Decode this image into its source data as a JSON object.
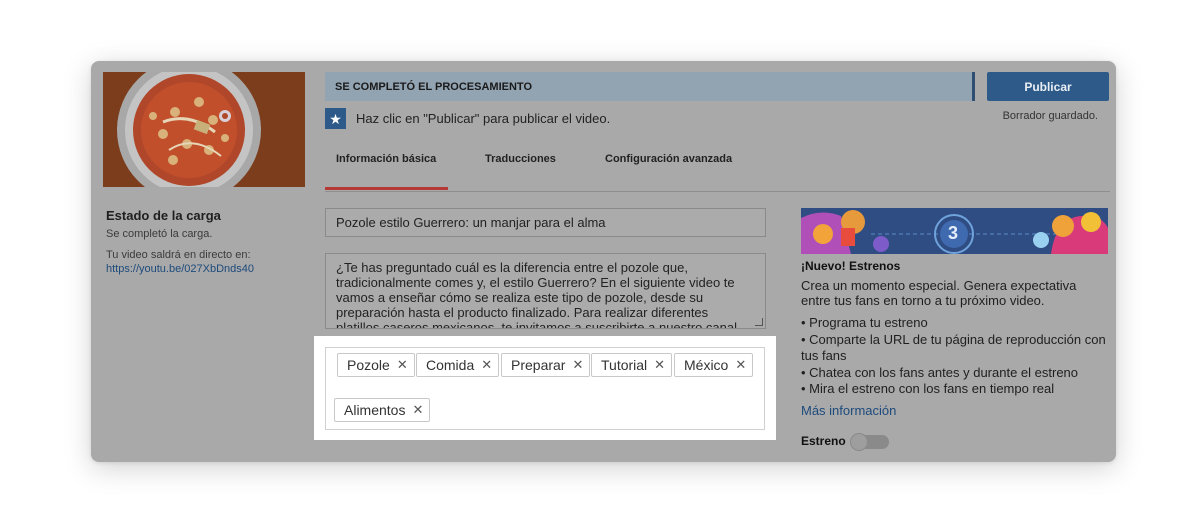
{
  "upload": {
    "title": "Estado de la carga",
    "status": "Se completó la carga.",
    "live_label": "Tu video saldrá en directo en:",
    "url": "https://youtu.be/027XbDnds40"
  },
  "processing": {
    "status": "SE COMPLETÓ EL PROCESAMIENTO",
    "hint": "Haz clic en \"Publicar\" para publicar el video.",
    "publish_label": "Publicar",
    "draft_saved": "Borrador guardado."
  },
  "tabs": [
    {
      "label": "Información básica",
      "active": true
    },
    {
      "label": "Traducciones",
      "active": false
    },
    {
      "label": "Configuración avanzada",
      "active": false
    }
  ],
  "form": {
    "title_value": "Pozole estilo Guerrero: un manjar para el alma",
    "description_value": "¿Te has preguntado cuál es la diferencia entre el pozole que, tradicionalmente comes y, el estilo Guerrero? En el siguiente video te vamos a enseñar cómo se realiza este tipo de pozole, desde su preparación hasta el producto finalizado. Para realizar diferentes platillos caseros mexicanos, te invitamos a suscribirte a nuestro canal.",
    "tags": [
      "Pozole",
      "Comida",
      "Preparar",
      "Tutorial",
      "México",
      "Alimentos"
    ]
  },
  "promo": {
    "banner_number": "3",
    "title": "¡Nuevo! Estrenos",
    "description": "Crea un momento especial. Genera expectativa entre tus fans en torno a tu próximo video.",
    "items": [
      "Programa tu estreno",
      "Comparte la URL de tu página de reproducción con tus fans",
      "Chatea con los fans antes y durante el estreno",
      "Mira el estreno con los fans en tiempo real"
    ],
    "more_info": "Más información",
    "premiere_label": "Estreno",
    "premiere_enabled": false
  },
  "icons": {
    "star": "star-icon",
    "tag_remove": "close-icon"
  },
  "colors": {
    "accent": "#2e5a8a",
    "tab_active": "#b73935",
    "link": "#1d4a7c"
  }
}
